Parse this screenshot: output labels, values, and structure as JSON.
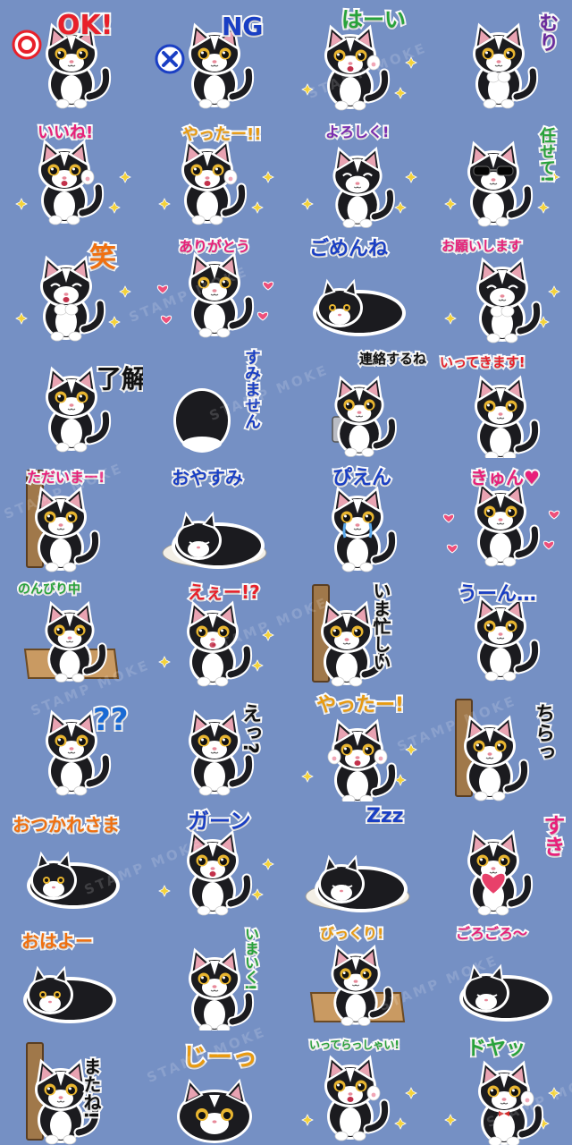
{
  "background_color": "#7590c4",
  "watermark": "STAMP MOKE",
  "stickers": [
    {
      "label": "OK!",
      "color": "#e8202a",
      "pose": "sit",
      "sign": "○",
      "sign_color": "#e8202a"
    },
    {
      "label": "NG",
      "color": "#1a3fc4",
      "pose": "sit",
      "sign": "×",
      "sign_color": "#1a3fc4"
    },
    {
      "label": "はーい",
      "color": "#27a33a",
      "pose": "wave"
    },
    {
      "label": "むり",
      "color": "#6a2a9e",
      "pose": "cross",
      "vertical": true
    },
    {
      "label": "いいね!",
      "color": "#e8207a",
      "pose": "wave"
    },
    {
      "label": "やったー!!",
      "color": "#e89a10",
      "pose": "wave"
    },
    {
      "label": "よろしく!",
      "color": "#7a2ab0",
      "pose": "bow"
    },
    {
      "label": "任せて!",
      "color": "#27a33a",
      "pose": "sunglasses",
      "vertical": true
    },
    {
      "label": "笑",
      "color": "#f07010",
      "pose": "laugh"
    },
    {
      "label": "ありがとう",
      "color": "#e8207a",
      "pose": "sit",
      "hearts": true
    },
    {
      "label": "ごめんね",
      "color": "#1a3fc4",
      "pose": "lie"
    },
    {
      "label": "お願いします",
      "color": "#e8207a",
      "pose": "pray"
    },
    {
      "label": "了解",
      "color": "#111111",
      "pose": "sit"
    },
    {
      "label": "すみません",
      "color": "#1a3fc4",
      "pose": "back",
      "vertical": true
    },
    {
      "label": "連絡するね",
      "color": "#111111",
      "pose": "laptop"
    },
    {
      "label": "いってきます!",
      "color": "#e8202a",
      "pose": "run"
    },
    {
      "label": "ただいまー!",
      "color": "#e8207a",
      "pose": "door"
    },
    {
      "label": "おやすみ",
      "color": "#1a3fc4",
      "pose": "sleep"
    },
    {
      "label": "ぴえん",
      "color": "#1a3fc4",
      "pose": "cry"
    },
    {
      "label": "きゅん♥",
      "color": "#e8207a",
      "pose": "sit",
      "hearts": true
    },
    {
      "label": "のんびり中",
      "color": "#27a33a",
      "pose": "box"
    },
    {
      "label": "えぇー!?",
      "color": "#e8202a",
      "pose": "shock"
    },
    {
      "label": "いま忙しい",
      "color": "#111111",
      "pose": "door",
      "vertical": true
    },
    {
      "label": "うーん…",
      "color": "#1a3fc4",
      "pose": "sit"
    },
    {
      "label": "??",
      "color": "#1a6ad4",
      "pose": "sit"
    },
    {
      "label": "えっ?",
      "color": "#111111",
      "pose": "sit",
      "vertical": true
    },
    {
      "label": "やったー!",
      "color": "#e89a10",
      "pose": "cheer"
    },
    {
      "label": "ちらっ",
      "color": "#111111",
      "pose": "door",
      "vertical": true
    },
    {
      "label": "おつかれさま",
      "color": "#f07010",
      "pose": "lie"
    },
    {
      "label": "ガーン",
      "color": "#1a3fc4",
      "pose": "shock"
    },
    {
      "label": "Zzz",
      "color": "#1a3fc4",
      "pose": "sleep"
    },
    {
      "label": "すき",
      "color": "#e8207a",
      "pose": "heart",
      "vertical": true
    },
    {
      "label": "おはよー",
      "color": "#f07010",
      "pose": "stretch"
    },
    {
      "label": "いまいく!",
      "color": "#27a33a",
      "pose": "run",
      "vertical": true
    },
    {
      "label": "びっくり!",
      "color": "#e89a10",
      "pose": "box"
    },
    {
      "label": "ごろごろ〜",
      "color": "#e8207a",
      "pose": "roll"
    },
    {
      "label": "またね!",
      "color": "#111111",
      "pose": "door",
      "vertical": true
    },
    {
      "label": "じーっ",
      "color": "#e89a10",
      "pose": "peek"
    },
    {
      "label": "いってらっしゃい!",
      "color": "#27a33a",
      "pose": "wave"
    },
    {
      "label": "ドヤッ",
      "color": "#27a33a",
      "pose": "proud"
    }
  ]
}
